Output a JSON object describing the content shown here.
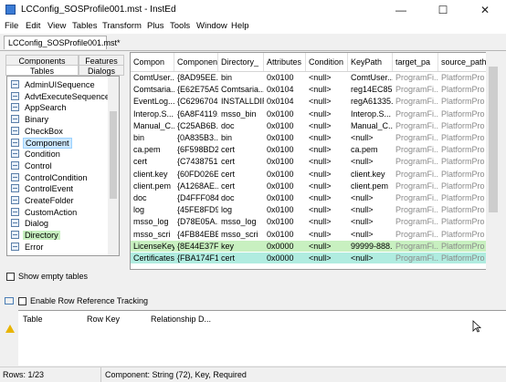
{
  "window": {
    "title": "LCConfig_SOSProfile001.mst - InstEd",
    "minimize_glyph": "—",
    "maximize_glyph": "☐",
    "close_glyph": "✕"
  },
  "menu": [
    "File",
    "Edit",
    "View",
    "Tables",
    "Transform",
    "Plus",
    "Tools",
    "Window",
    "Help"
  ],
  "doc_tab": "LCConfig_SOSProfile001.mst*",
  "left_tabs": {
    "components": "Components",
    "features": "Features",
    "tables": "Tables",
    "dialogs": "Dialogs"
  },
  "tables_list": [
    "AdminUISequence",
    "AdvtExecuteSequence",
    "AppSearch",
    "Binary",
    "CheckBox",
    "Component",
    "Condition",
    "Control",
    "ControlCondition",
    "ControlEvent",
    "CreateFolder",
    "CustomAction",
    "Dialog",
    "Directory",
    "Error"
  ],
  "show_empty_tables": "Show empty tables",
  "grid": {
    "columns": [
      "Compon",
      "Componen...",
      "Directory_",
      "Attributes",
      "Condition",
      "KeyPath",
      "target_pa",
      "source_path"
    ],
    "rows": [
      [
        "ComtUser...",
        "{8AD95EE...",
        "bin",
        "0x0100",
        "<null>",
        "ComtUser...",
        "ProgramFi...",
        "PlatformPro"
      ],
      [
        "Comtsaria...",
        "{E62E75A5...",
        "Comtsaria...",
        "0x0104",
        "<null>",
        "reg14EC85...",
        "ProgramFi...",
        "PlatformPro"
      ],
      [
        "EventLog...",
        "{C6296704...",
        "INSTALLDIR",
        "0x0104",
        "<null>",
        "regA61335...",
        "ProgramFi...",
        "PlatformPro"
      ],
      [
        "Interop.S...",
        "{6A8F4119...",
        "msso_bin",
        "0x0100",
        "<null>",
        "Interop.S...",
        "ProgramFi...",
        "PlatformPro"
      ],
      [
        "Manual_C...",
        "{C25AB6B...",
        "doc",
        "0x0100",
        "<null>",
        "Manual_C...",
        "ProgramFi...",
        "PlatformPro"
      ],
      [
        "bin",
        "{0A835B3...",
        "bin",
        "0x0100",
        "<null>",
        "<null>",
        "ProgramFi...",
        "PlatformPro"
      ],
      [
        "ca.pem",
        "{6F598BD2...",
        "cert",
        "0x0100",
        "<null>",
        "ca.pem",
        "ProgramFi...",
        "PlatformPro"
      ],
      [
        "cert",
        "{C7438751...",
        "cert",
        "0x0100",
        "<null>",
        "<null>",
        "ProgramFi...",
        "PlatformPro"
      ],
      [
        "client.key",
        "{60FD026E...",
        "cert",
        "0x0100",
        "<null>",
        "client.key",
        "ProgramFi...",
        "PlatformPro"
      ],
      [
        "client.pem",
        "{A1268AE...",
        "cert",
        "0x0100",
        "<null>",
        "client.pem",
        "ProgramFi...",
        "PlatformPro"
      ],
      [
        "doc",
        "{D4FFF084...",
        "doc",
        "0x0100",
        "<null>",
        "<null>",
        "ProgramFi...",
        "PlatformPro"
      ],
      [
        "log",
        "{45FE8FD9...",
        "log",
        "0x0100",
        "<null>",
        "<null>",
        "ProgramFi...",
        "PlatformPro"
      ],
      [
        "msso_log",
        "{D78E05A...",
        "msso_log",
        "0x0100",
        "<null>",
        "<null>",
        "ProgramFi...",
        "PlatformPro"
      ],
      [
        "msso_scri",
        "{4FB84EBB...",
        "msso_scri",
        "0x0100",
        "<null>",
        "<null>",
        "ProgramFi...",
        "PlatformPro"
      ],
      [
        "LicenseKey",
        "{8E44E37F...",
        "key",
        "0x0000",
        "<null>",
        "99999-888...",
        "ProgramFi...",
        "PlatformPro"
      ],
      [
        "Certificates",
        "{FBA174F1...",
        "cert",
        "0x0000",
        "<null>",
        "<null>",
        "ProgramFi...",
        "PlatformPro"
      ]
    ]
  },
  "row_reference": {
    "enable_label": "Enable Row Reference Tracking",
    "columns": [
      "Table",
      "Row Key",
      "Relationship D..."
    ]
  },
  "status": {
    "rows": "Rows: 1/23",
    "component": "Component: String (72), Key, Required"
  },
  "colors": {
    "selected_green": "#c8f0c0",
    "selected_teal": "#b0ece0",
    "tree_selected_blue": "#cde8ff"
  }
}
